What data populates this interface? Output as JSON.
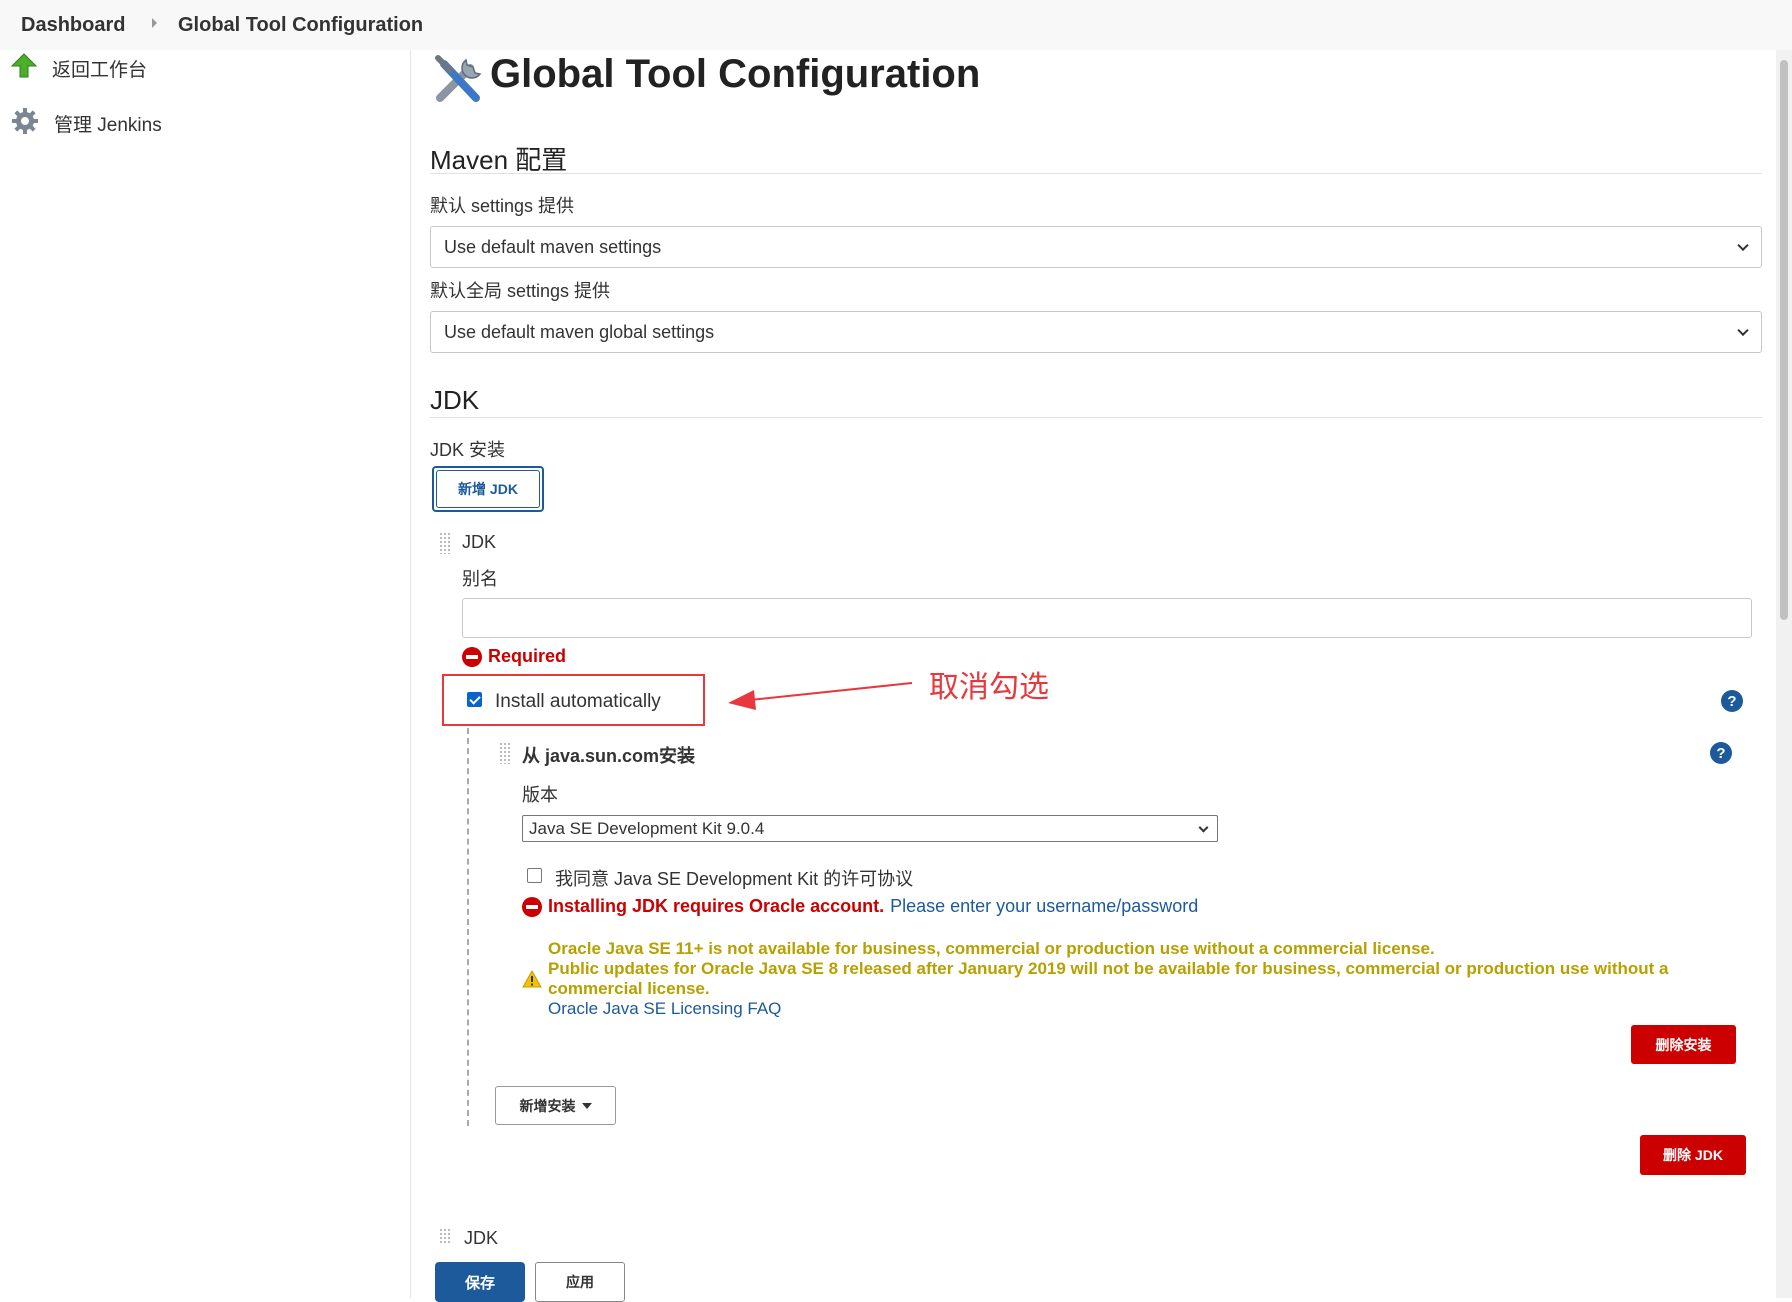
{
  "breadcrumb": {
    "items": [
      "Dashboard",
      "Global Tool Configuration"
    ]
  },
  "sidebar": {
    "items": [
      {
        "label": "返回工作台",
        "icon": "up-arrow-icon"
      },
      {
        "label": "管理 Jenkins",
        "icon": "gear-icon"
      }
    ]
  },
  "page": {
    "title": "Global Tool Configuration",
    "icon": "tools-icon"
  },
  "maven": {
    "heading": "Maven 配置",
    "settings_label": "默认 settings 提供",
    "settings_value": "Use default maven settings",
    "global_label": "默认全局 settings 提供",
    "global_value": "Use default maven global settings"
  },
  "jdk": {
    "heading": "JDK",
    "installs_label": "JDK 安装",
    "add_button": "新增 JDK",
    "item_title": "JDK",
    "alias_label": "别名",
    "alias_value": "",
    "required_msg": "Required",
    "install_auto_label": "Install automatically",
    "install_auto_checked": true,
    "installer_title": "从 java.sun.com安装",
    "version_label": "版本",
    "version_value": "Java SE Development Kit 9.0.4",
    "agree_label": "我同意 Java SE Development Kit 的许可协议",
    "agree_checked": false,
    "oracle_error": "Installing JDK requires Oracle account.",
    "oracle_link": "Please enter your username/password",
    "warning_line1": "Oracle Java SE 11+ is not available for business, commercial or production use without a commercial license.",
    "warning_line2": "Public updates for Oracle Java SE 8 released after January 2019 will not be available for business, commercial or production use without a commercial license.",
    "warning_link": "Oracle Java SE Licensing FAQ",
    "delete_installer_button": "删除安装",
    "add_installer_button": "新增安装",
    "delete_jdk_button": "删除 JDK",
    "next_item_title": "JDK"
  },
  "annotation": {
    "text": "取消勾选",
    "color": "#e8383d"
  },
  "footer": {
    "save_button": "保存",
    "apply_button": "应用"
  },
  "colors": {
    "accent": "#1c5a9c",
    "danger": "#cc0000",
    "warning": "#b8a000"
  }
}
